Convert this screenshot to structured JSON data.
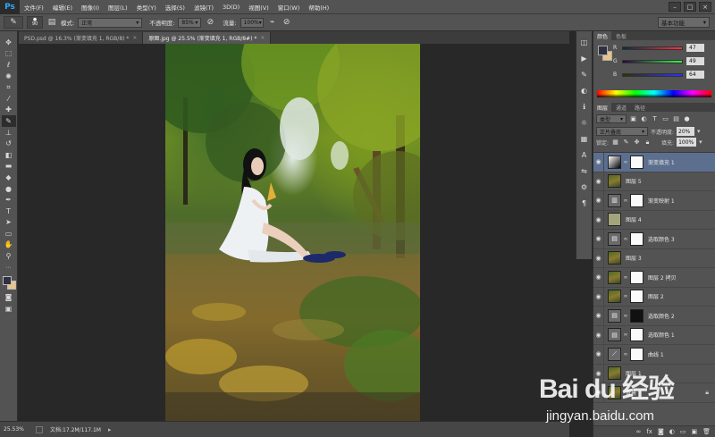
{
  "app": {
    "logo": "Ps"
  },
  "menu": [
    "文件(F)",
    "编辑(E)",
    "图像(I)",
    "图层(L)",
    "类型(Y)",
    "选择(S)",
    "滤镜(T)",
    "3D(D)",
    "视图(V)",
    "窗口(W)",
    "帮助(H)"
  ],
  "window_controls": {
    "minimize": "–",
    "maximize": "□",
    "close": "×"
  },
  "options": {
    "brush_size": "90",
    "mode_label": "模式:",
    "mode_value": "正常",
    "opacity_label": "不透明度:",
    "opacity_value": "85%",
    "flow_label": "流量:",
    "flow_value": "100%",
    "workspace": "基本功能"
  },
  "tabs": [
    {
      "title": "PSD.psd @ 16.3% (渐变填充 1, RGB/8) *",
      "close": "×"
    },
    {
      "title": "原图.jpg @ 25.5% (渐变填充 1, RGB/8#) *",
      "close": "×"
    }
  ],
  "status": {
    "zoom": "25.53%",
    "doc": "文档:17.2M/117.1M"
  },
  "color_panel": {
    "tabs": [
      "颜色",
      "色板"
    ],
    "channels": [
      {
        "label": "R",
        "value": "47"
      },
      {
        "label": "G",
        "value": "49"
      },
      {
        "label": "B",
        "value": "64"
      }
    ],
    "foreground": "#2f3040",
    "background": "#e8c48a"
  },
  "layers_panel": {
    "tabs": [
      "图层",
      "通道",
      "路径"
    ],
    "filter_label": "类型",
    "blend_mode": "正片叠底",
    "opacity_label": "不透明度:",
    "opacity_value": "20%",
    "lock_label": "锁定:",
    "fill_label": "填充:",
    "fill_value": "100%",
    "layers": [
      {
        "name": "渐变填充 1",
        "thumb": "grad",
        "mask": "white",
        "selected": true
      },
      {
        "name": "图层 5",
        "thumb": "photo",
        "mask": "none",
        "selected": false
      },
      {
        "name": "渐变映射 1",
        "thumb": "adj",
        "mask": "white",
        "selected": false
      },
      {
        "name": "图层 4",
        "thumb": "green",
        "mask": "none",
        "selected": false
      },
      {
        "name": "选取颜色 3",
        "thumb": "adj",
        "mask": "white",
        "selected": false
      },
      {
        "name": "图层 3",
        "thumb": "photo",
        "mask": "none",
        "selected": false
      },
      {
        "name": "图层 2 拷贝",
        "thumb": "photo",
        "mask": "white",
        "selected": false
      },
      {
        "name": "图层 2",
        "thumb": "photo",
        "mask": "white",
        "selected": false
      },
      {
        "name": "选取颜色 2",
        "thumb": "adj",
        "mask": "black",
        "selected": false
      },
      {
        "name": "选取颜色 1",
        "thumb": "adj",
        "mask": "white",
        "selected": false
      },
      {
        "name": "曲线 1",
        "thumb": "adj",
        "mask": "white",
        "selected": false
      },
      {
        "name": "图层 1",
        "thumb": "photo",
        "mask": "none",
        "selected": false
      },
      {
        "name": "背景",
        "thumb": "photo",
        "mask": "none",
        "selected": false
      }
    ]
  },
  "watermark": {
    "logo": "Bai du 经验",
    "url": "jingyan.baidu.com"
  }
}
